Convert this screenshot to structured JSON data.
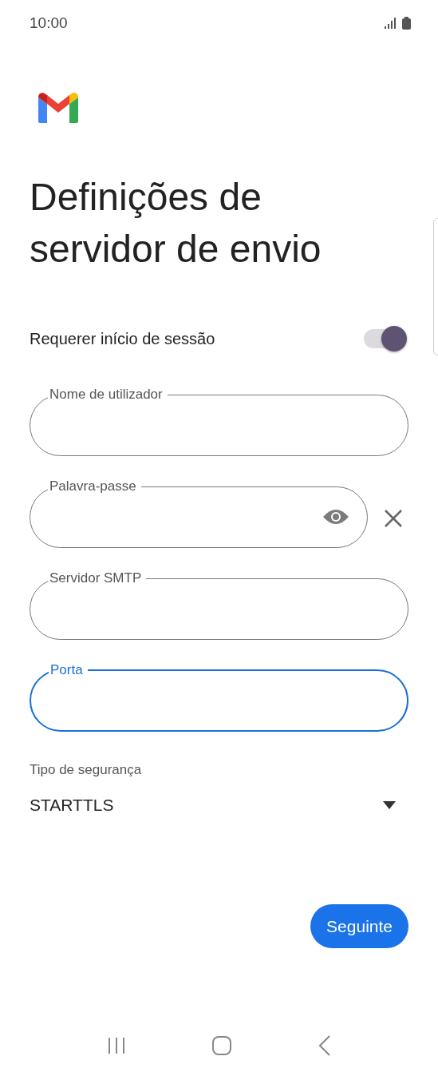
{
  "status_bar": {
    "time": "10:00"
  },
  "title": "Definições de servidor de envio",
  "require_login": {
    "label": "Requerer início de sessão",
    "on": true
  },
  "fields": [
    {
      "label": "Nome de utilizador",
      "kind": "text",
      "focused": false
    },
    {
      "label": "Palavra-passe",
      "kind": "password",
      "focused": false
    },
    {
      "label": "Servidor SMTP",
      "kind": "text",
      "focused": false
    },
    {
      "label": "Porta",
      "kind": "text",
      "focused": true
    }
  ],
  "security": {
    "label": "Tipo de segurança",
    "value": "STARTTLS"
  },
  "next_button": "Seguinte"
}
